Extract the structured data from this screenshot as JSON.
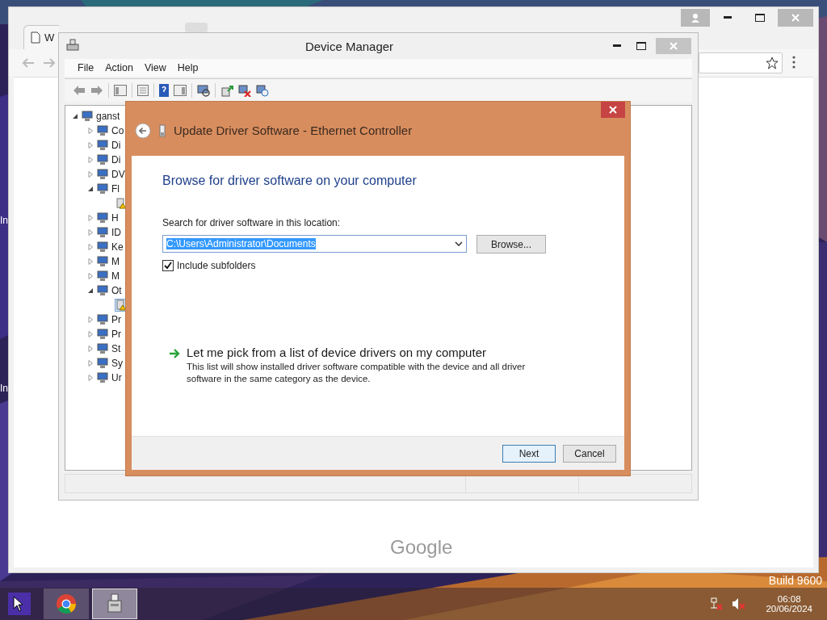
{
  "desktop": {
    "labels": [
      "In",
      "In"
    ],
    "build_text": "Build 9600"
  },
  "browser": {
    "tab": {
      "title": "W",
      "selected": true
    },
    "page_logo": "Google"
  },
  "device_manager": {
    "title": "Device Manager",
    "menu": [
      "File",
      "Action",
      "View",
      "Help"
    ],
    "tree": [
      {
        "label": "ganst",
        "expanded": true,
        "children": [
          {
            "label": "Co",
            "expanded": false
          },
          {
            "label": "Di",
            "expanded": false
          },
          {
            "label": "Di",
            "expanded": false
          },
          {
            "label": "DV",
            "expanded": false
          },
          {
            "label": "Fl",
            "expanded": true,
            "children": [
              {
                "selected": false,
                "warning": true
              }
            ]
          },
          {
            "label": "H",
            "expanded": false
          },
          {
            "label": "ID",
            "expanded": false
          },
          {
            "label": "Ke",
            "expanded": false
          },
          {
            "label": "M",
            "expanded": false
          },
          {
            "label": "M",
            "expanded": false
          },
          {
            "label": "Ot",
            "expanded": true,
            "children": [
              {
                "selected": true,
                "warning": true
              }
            ]
          },
          {
            "label": "Pr",
            "expanded": false
          },
          {
            "label": "Pr",
            "expanded": false
          },
          {
            "label": "St",
            "expanded": false
          },
          {
            "label": "Sy",
            "expanded": false
          },
          {
            "label": "Ur",
            "expanded": false
          }
        ]
      }
    ]
  },
  "dialog": {
    "title": "Update Driver Software - Ethernet Controller",
    "heading": "Browse for driver software on your computer",
    "location_label": "Search for driver software in this location:",
    "location": {
      "value": "C:\\Users\\Administrator\\Documents",
      "value_selected": true
    },
    "browse_button": "Browse...",
    "include_subfolders": {
      "label": "Include subfolders",
      "checked": true
    },
    "pick_option": {
      "title": "Let me pick from a list of device drivers on my computer",
      "description": "This list will show installed driver software compatible with the device and all driver software in the same category as the device."
    },
    "buttons": [
      {
        "label": "Next",
        "selected": true
      },
      {
        "label": "Cancel",
        "selected": false
      }
    ]
  },
  "taskbar": {
    "apps": [
      {
        "kind": "chrome",
        "selected": false
      },
      {
        "kind": "device-manager",
        "selected": true
      }
    ],
    "time": "06:08",
    "date": "20/06/2024"
  }
}
